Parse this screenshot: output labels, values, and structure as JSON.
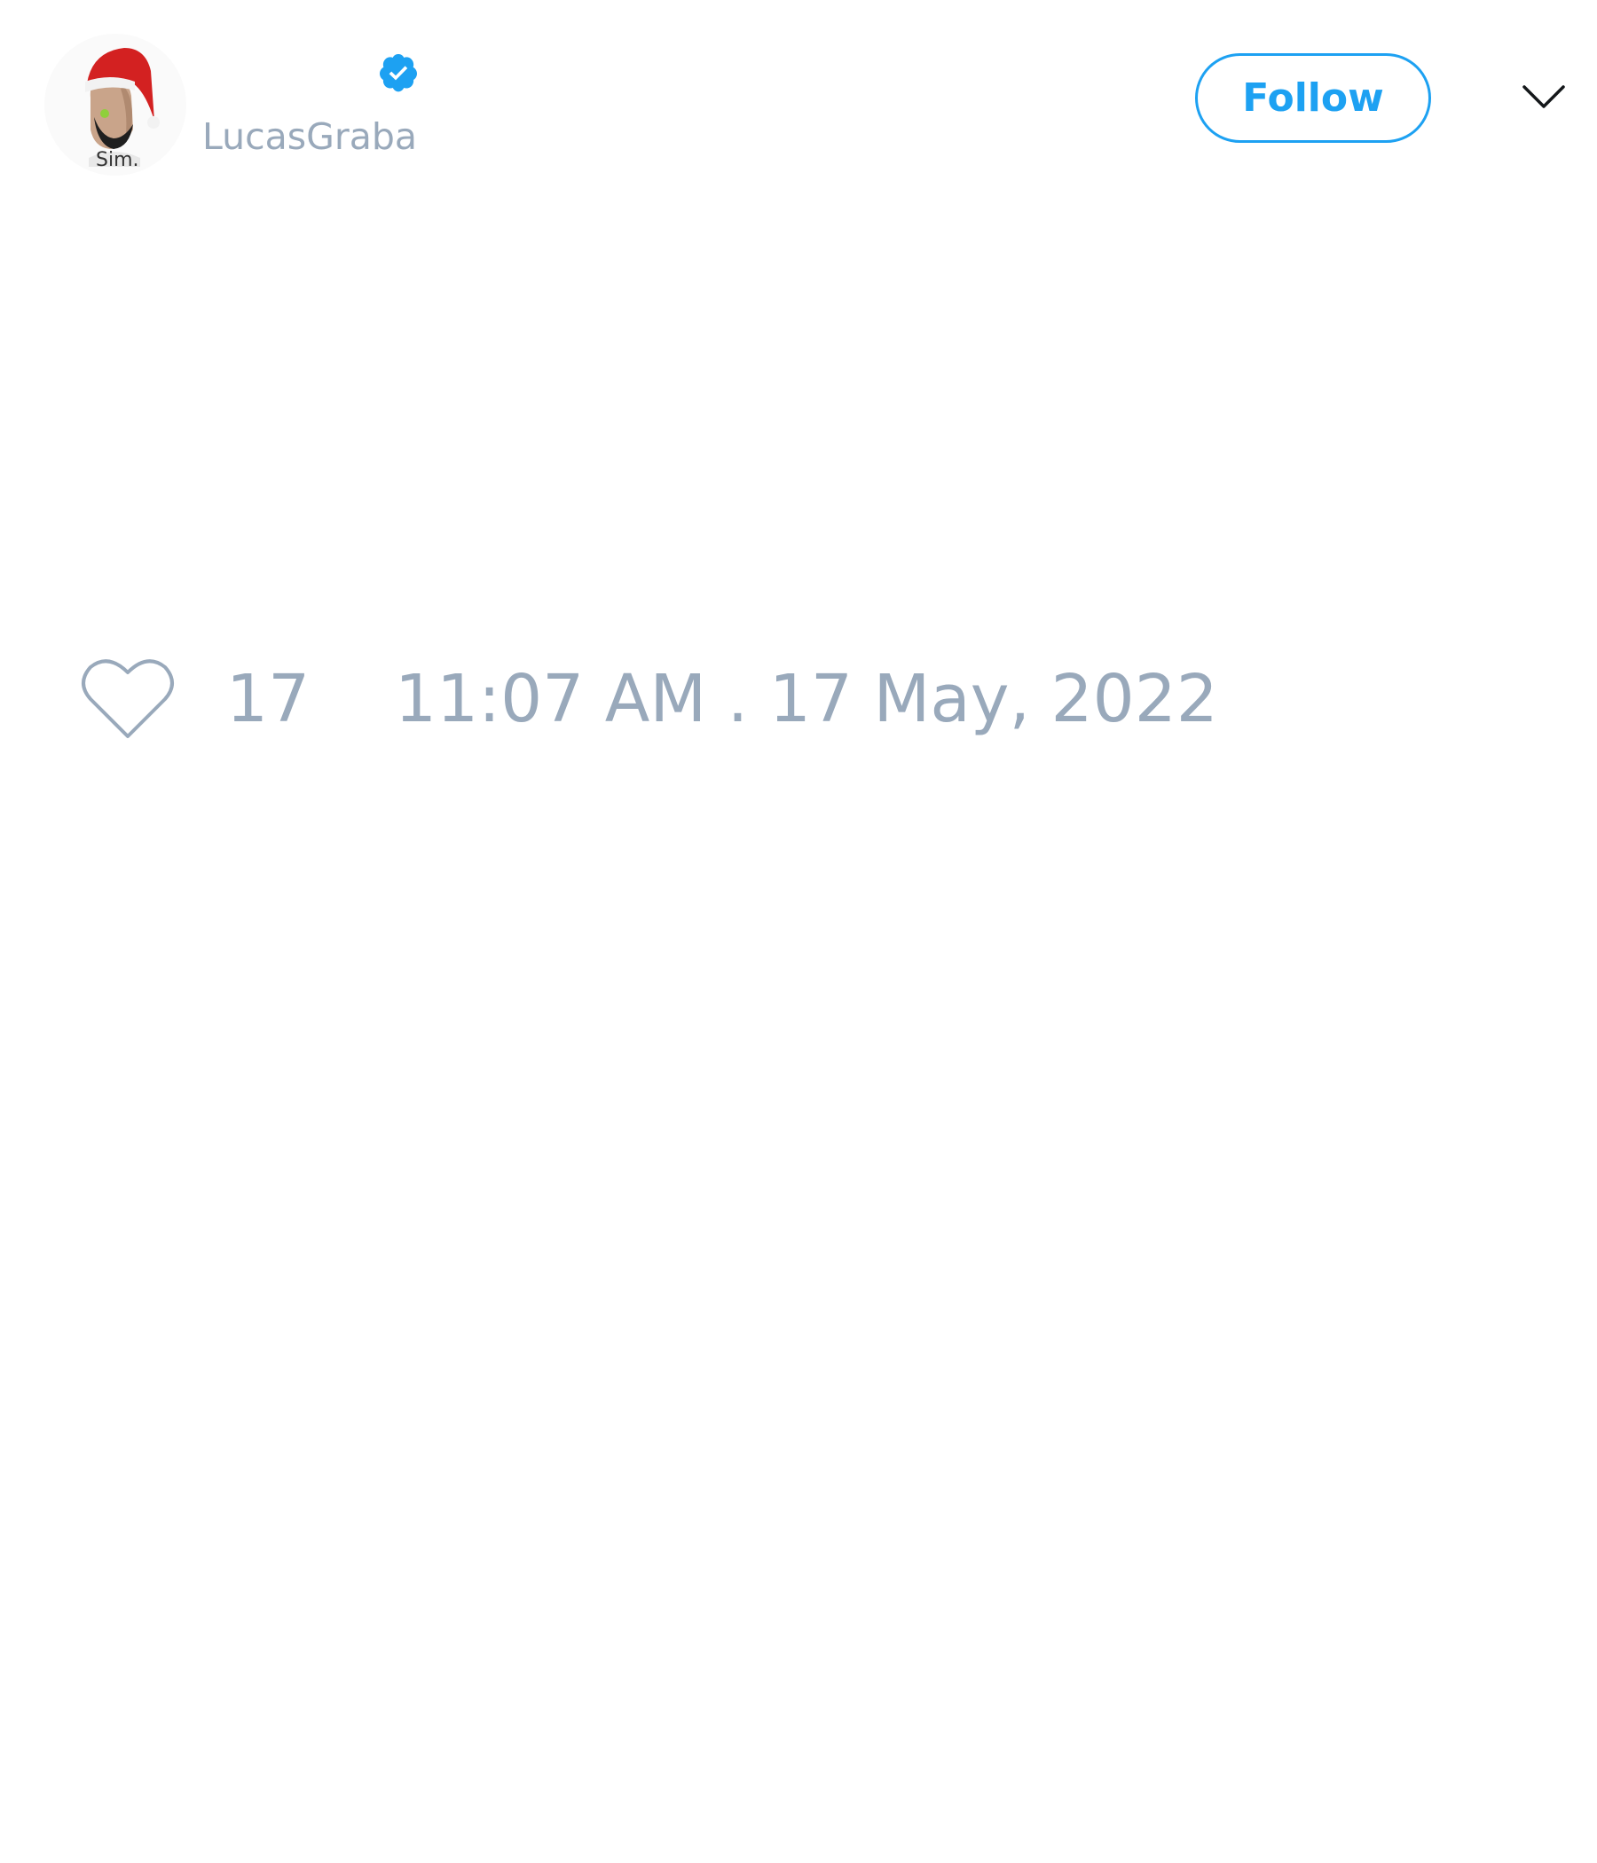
{
  "tweet": {
    "author": {
      "display_name": "",
      "handle": "LucasGraba",
      "verified": true,
      "avatar_caption": "Sim.",
      "avatar_icon": "avatar-santa-hat-icon"
    },
    "follow_label": "Follow",
    "menu_icon": "chevron-down-icon",
    "like_icon": "heart-icon",
    "like_count": "17",
    "timestamp": "11:07 AM . 17 May, 2022"
  },
  "colors": {
    "accent": "#1da1f2",
    "muted_text": "#99a9bb",
    "background": "#ffffff"
  }
}
